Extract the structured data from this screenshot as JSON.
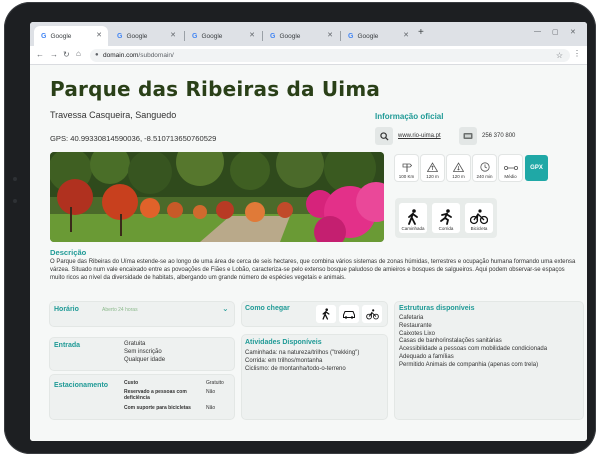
{
  "browser": {
    "tabs": [
      {
        "label": "Google",
        "active": true
      },
      {
        "label": "Google",
        "active": false
      },
      {
        "label": "Google",
        "active": false
      },
      {
        "label": "Google",
        "active": false
      },
      {
        "label": "Google",
        "active": false
      }
    ],
    "url_domain": "domain.com",
    "url_path": "/subdomain/"
  },
  "park": {
    "title": "Parque das Ribeiras da Uima",
    "address": "Travessa Casqueira, Sanguedo",
    "gps": "GPS: 40.99330814590036, -8.510713650760529"
  },
  "official": {
    "heading": "Informação oficial",
    "website": "www.rio-uima.pt",
    "phone": "256 370 800"
  },
  "stats": [
    {
      "icon": "sign-icon",
      "label": "100 Km"
    },
    {
      "icon": "mountain-up-icon",
      "label": "120 m"
    },
    {
      "icon": "mountain-down-icon",
      "label": "120 m"
    },
    {
      "icon": "clock-icon",
      "label": "240 min"
    },
    {
      "icon": "route-icon",
      "label": "Médio"
    }
  ],
  "gpx_label": "GPX",
  "modes": [
    {
      "icon": "walking-icon",
      "label": "Caminhada"
    },
    {
      "icon": "running-icon",
      "label": "Corrida"
    },
    {
      "icon": "bicycle-icon",
      "label": "Bicicleta"
    }
  ],
  "description": {
    "heading": "Descrição",
    "text": "O Parque das Ribeiras do Uíma estende-se ao longo de uma área de cerca de seis hectares, que combina vários sistemas de zonas húmidas, terrestres e ocupação humana formando uma extensa várzea. Situado num vale encaixado entre as povoações de Fiães e Lobão, caracteriza-se pelo extenso bosque paludoso de amieiros e bosques de salgueiros. Aqui podem observar-se espaços muito ricos ao nível da diversidade de habitats, albergando um grande número de espécies vegetais e animais."
  },
  "schedule": {
    "heading": "Horário",
    "status": "Aberto 24 horas"
  },
  "entry": {
    "heading": "Entrada",
    "items": [
      "Gratuita",
      "Sem inscrição",
      "Qualquer idade"
    ]
  },
  "parking": {
    "heading": "Estacionamento",
    "rows": [
      {
        "label": "Custo",
        "value": "Gratuito"
      },
      {
        "label": "Reservado a pessoas com deficiência",
        "value": "Não"
      },
      {
        "label": "Com suporte para bicicletas",
        "value": "Não"
      }
    ]
  },
  "directions": {
    "heading": "Como chegar",
    "icons": [
      "walking-icon",
      "car-icon",
      "bicycle-icon"
    ]
  },
  "activities": {
    "heading": "Atividades Disponíveis",
    "items": [
      "Caminhada: na natureza/trilhos (\"trekking\")",
      "Corrida: em trilhos/montanha",
      "Ciclismo: de montanha/todo-o-terreno"
    ]
  },
  "facilities": {
    "heading": "Estruturas disponíveis",
    "items": [
      "Cafetaria",
      "Restaurante",
      "Caixotes Lixo",
      "Casas de banho/instalações sanitárias",
      "Acessibilidade a pessoas com mobilidade condicionada",
      "Adequado a famílias",
      "Permitido Animais de companhia (apenas com trela)"
    ]
  },
  "colors": {
    "accent": "#1f9a96",
    "title": "#2a4018",
    "gpx": "#1fa8a6"
  }
}
